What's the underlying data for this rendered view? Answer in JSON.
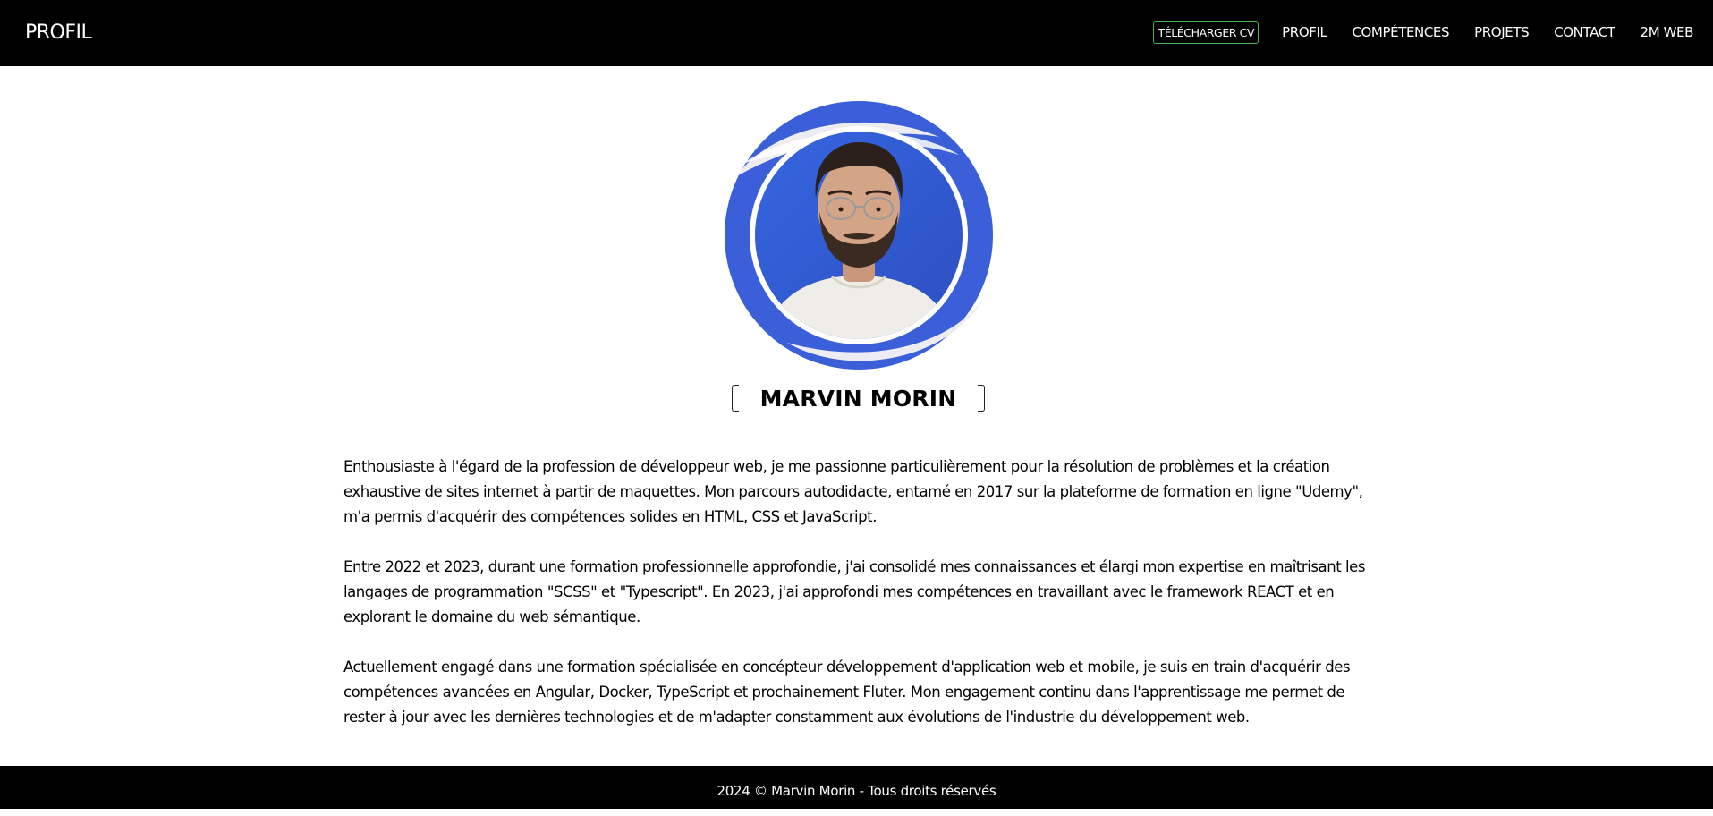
{
  "header": {
    "brand": "PROFIL",
    "nav": {
      "cv_button": "TÉLÉCHARGER CV",
      "profil": "PROFIL",
      "competences": "COMPÉTENCES",
      "projets": "PROJETS",
      "contact": "CONTACT",
      "web": "2M WEB"
    }
  },
  "profile": {
    "name": "MARVIN MORIN",
    "avatar_icon": "profile-photo",
    "ring_color": "#3a5fd9"
  },
  "bio": {
    "paragraphs": [
      "Enthousiaste à l'égard de la profession de développeur web, je me passionne particulièrement pour la résolution de problèmes et la création exhaustive de sites internet à partir de maquettes. Mon parcours autodidacte, entamé en 2017 sur la plateforme de formation en ligne \"Udemy\", m'a permis d'acquérir des compétences solides en HTML, CSS et JavaScript.",
      "Entre 2022 et 2023, durant une formation professionnelle approfondie, j'ai consolidé mes connaissances et élargi mon expertise en maîtrisant les langages de programmation \"SCSS\" et \"Typescript\". En 2023, j'ai approfondi mes compétences en travaillant avec le framework REACT et en explorant le domaine du web sémantique.",
      "Actuellement engagé dans une formation spécialisée en concépteur développement d'application web et mobile, je suis en train d'acquérir des compétences avancées en Angular, Docker, TypeScript et prochainement Fluter. Mon engagement continu dans l'apprentissage me permet de rester à jour avec les dernières technologies et de m'adapter constamment aux évolutions de l'industrie du développement web."
    ]
  },
  "footer": {
    "text": "2024 © Marvin Morin - Tous droits réservés"
  }
}
